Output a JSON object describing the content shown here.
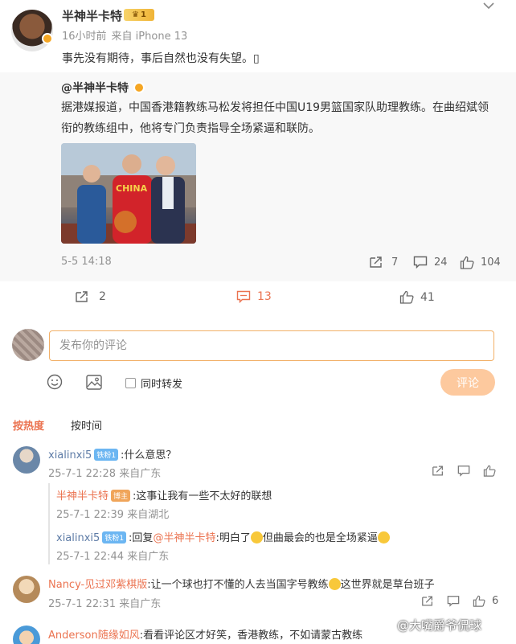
{
  "post": {
    "username": "半神半卡特",
    "crown_badge": "1",
    "time": "16小时前",
    "source": "来自 iPhone 13",
    "text": "事先没有期待，事后自然也没有失望。▯"
  },
  "repost": {
    "author": "@半神半卡特",
    "body": "据港媒报道，中国香港籍教练马松发将担任中国U19男篮国家队助理教练。在曲绍斌领衔的教练组中，他将专门负责指导全场紧逼和联防。",
    "image_text": "CHINA",
    "time": "5-5 14:18",
    "reposts": "7",
    "comments": "24",
    "likes": "104"
  },
  "actions": {
    "reposts": "2",
    "comments": "13",
    "likes": "41"
  },
  "composer": {
    "placeholder": "发布你的评论",
    "also_repost": "同时转发",
    "submit": "评论"
  },
  "tabs": {
    "hot": "按热度",
    "time": "按时间"
  },
  "comments": [
    {
      "user": "xialinxi5",
      "tag": "铁粉1",
      "text": ":什么意思？",
      "time": "25-7-1 22:28 来自广东",
      "replies": [
        {
          "user": "半神半卡特",
          "tag": "博主",
          "text": ":这事让我有一些不太好的联想",
          "time": "25-7-1 22:39 来自湖北"
        },
        {
          "user": "xialinxi5",
          "tag": "铁粉1",
          "prefix": ":回复",
          "mention": "@半神半卡特",
          "text_a": ":明白了",
          "text_b": "但曲最会的也是全场紧逼",
          "time": "25-7-1 22:44 来自广东"
        }
      ]
    },
    {
      "user": "Nancy-见过邓紫棋版",
      "text_a": ":让一个球也打不懂的人去当国字号教练",
      "text_b": "这世界就是草台班子",
      "time": "25-7-1 22:31 来自广东",
      "likes": "6"
    },
    {
      "user": "Anderson随缘如风",
      "text": ":看看评论区才好笑，香港教练，不如请蒙古教练"
    }
  ],
  "watermark": "@大嘴爵爷侃球",
  "colors": {
    "accent": "#eb7350",
    "link": "#5d7ba6",
    "submit_disabled": "#fdc99e"
  }
}
